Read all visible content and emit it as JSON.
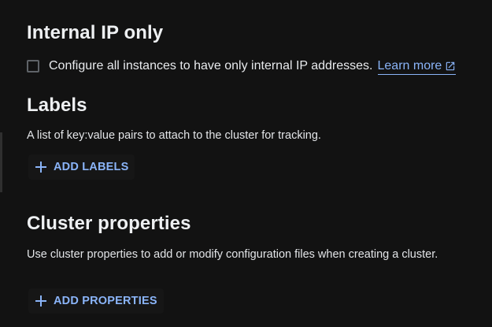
{
  "internal_ip": {
    "title": "Internal IP only",
    "checkbox_label": "Configure all instances to have only internal IP addresses.",
    "checked": false,
    "learn_more_label": "Learn more",
    "learn_more_icon": "open-in-new-icon"
  },
  "labels": {
    "title": "Labels",
    "description": "A list of key:value pairs to attach to the cluster for tracking.",
    "add_button_label": "ADD LABELS",
    "add_button_icon": "plus-icon"
  },
  "cluster_properties": {
    "title": "Cluster properties",
    "description": "Use cluster properties to add or modify configuration files when creating a cluster.",
    "add_button_label": "ADD PROPERTIES",
    "add_button_icon": "plus-icon"
  },
  "colors": {
    "background": "#121212",
    "text": "#e8eaed",
    "accent": "#8ab4f8"
  }
}
